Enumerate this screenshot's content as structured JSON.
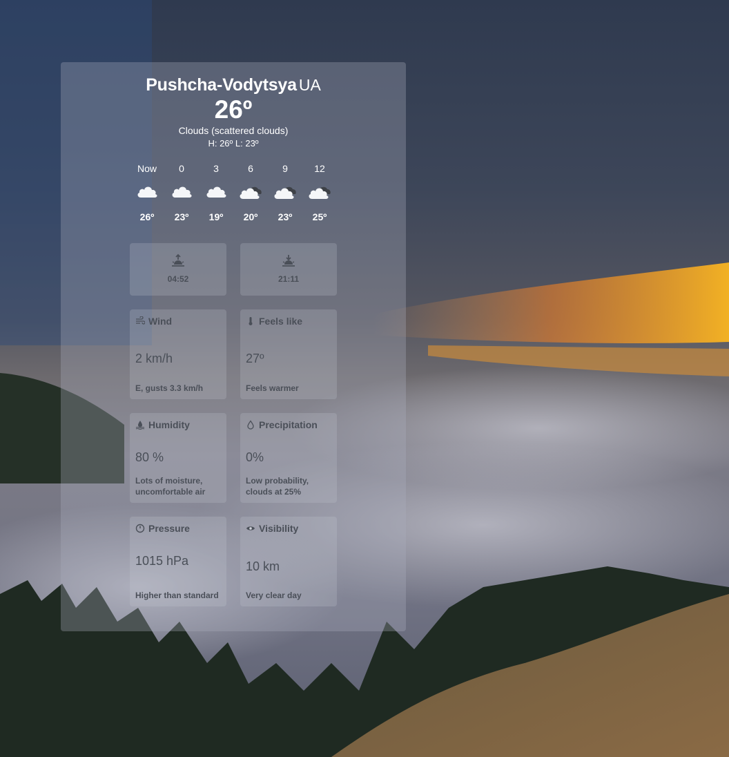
{
  "location": {
    "city": "Pushcha-Vodytsya",
    "country": "UA"
  },
  "current": {
    "temperature": "26º",
    "condition": "Clouds (scattered clouds)",
    "high_low": "H: 26º L: 23º"
  },
  "hourly": [
    {
      "label": "Now",
      "icon": "cloud-icon",
      "temp": "26º"
    },
    {
      "label": "0",
      "icon": "cloud-icon",
      "temp": "23º"
    },
    {
      "label": "3",
      "icon": "cloud-icon",
      "temp": "19º"
    },
    {
      "label": "6",
      "icon": "cloud-dark-icon",
      "temp": "20º"
    },
    {
      "label": "9",
      "icon": "cloud-dark-icon",
      "temp": "23º"
    },
    {
      "label": "12",
      "icon": "cloud-dark-icon",
      "temp": "25º"
    }
  ],
  "sun": {
    "sunrise": "04:52",
    "sunset": "21:11"
  },
  "cards": {
    "wind": {
      "title": "Wind",
      "value": "2 km/h",
      "note": "E, gusts 3.3 km/h"
    },
    "feels_like": {
      "title": "Feels like",
      "value": "27º",
      "note": "Feels warmer"
    },
    "humidity": {
      "title": "Humidity",
      "value": "80 %",
      "note": "Lots of moisture, uncomfortable air"
    },
    "precipitation": {
      "title": "Precipitation",
      "value": "0%",
      "note": "Low probability, clouds at 25%"
    },
    "pressure": {
      "title": "Pressure",
      "value": "1015 hPa",
      "note": "Higher than standard"
    },
    "visibility": {
      "title": "Visibility",
      "value": "10 km",
      "note": "Very clear day"
    }
  }
}
